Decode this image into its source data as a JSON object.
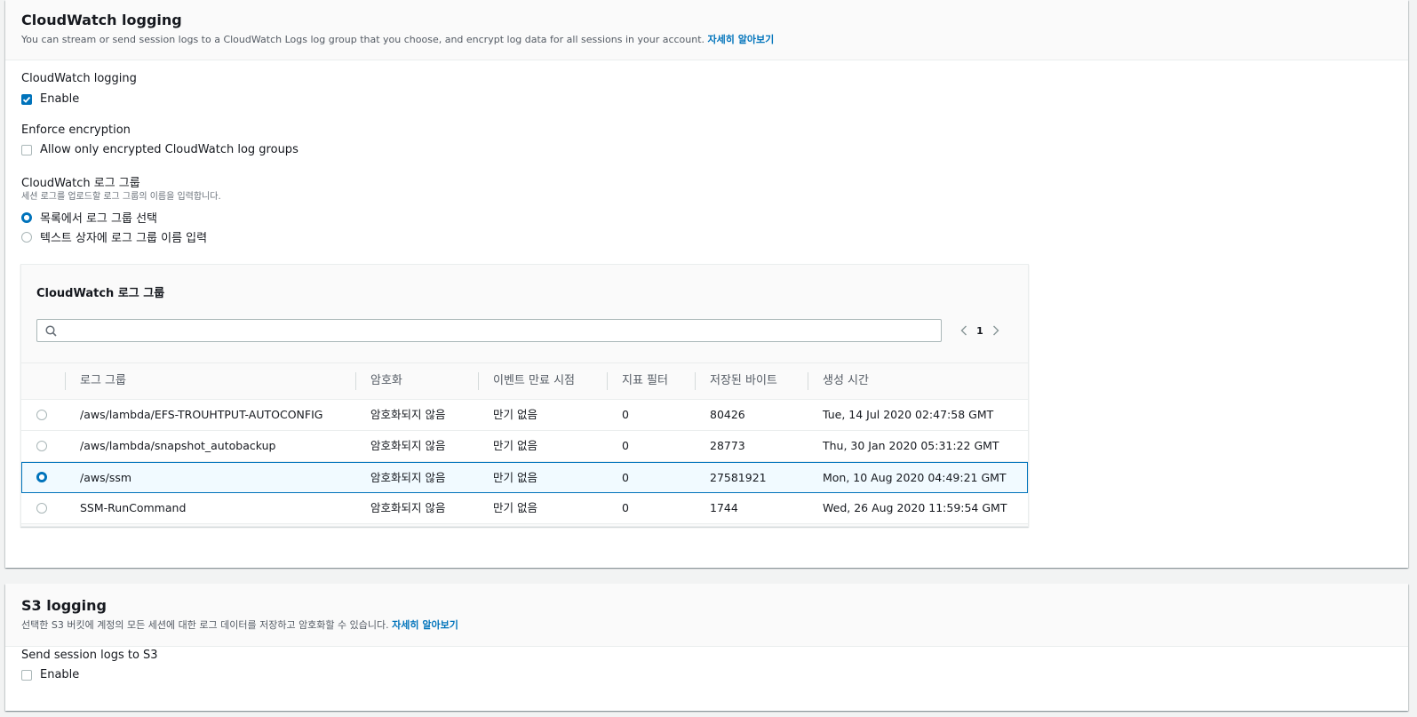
{
  "cloudwatch": {
    "title": "CloudWatch logging",
    "description": "You can stream or send session logs to a CloudWatch Logs log group that you choose, and encrypt log data for all sessions in your account.",
    "learn_more": "자세히 알아보기",
    "logging_label": "CloudWatch logging",
    "enable_label": "Enable",
    "enable_checked": true,
    "encryption_label": "Enforce encryption",
    "encryption_option": "Allow only encrypted CloudWatch log groups",
    "encryption_checked": false,
    "log_group_label": "CloudWatch 로그 그룹",
    "log_group_sub": "세션 로그를 업로드할 로그 그룹의 이름을 입력합니다.",
    "radio_select": "목록에서 로그 그룹 선택",
    "radio_text": "텍스트 상자에 로그 그룹 이름 입력",
    "selected_radio": "select"
  },
  "table": {
    "title": "CloudWatch 로그 그룹",
    "search_placeholder": "",
    "page": "1",
    "columns": [
      "로그 그룹",
      "암호화",
      "이벤트 만료 시점",
      "지표 필터",
      "저장된 바이트",
      "생성 시간"
    ],
    "rows": [
      {
        "name": "/aws/lambda/EFS-TROUHTPUT-AUTOCONFIG",
        "encryption": "암호화되지 않음",
        "expiry": "만기 없음",
        "filters": "0",
        "bytes": "80426",
        "created": "Tue, 14 Jul 2020 02:47:58 GMT",
        "selected": false
      },
      {
        "name": "/aws/lambda/snapshot_autobackup",
        "encryption": "암호화되지 않음",
        "expiry": "만기 없음",
        "filters": "0",
        "bytes": "28773",
        "created": "Thu, 30 Jan 2020 05:31:22 GMT",
        "selected": false
      },
      {
        "name": "/aws/ssm",
        "encryption": "암호화되지 않음",
        "expiry": "만기 없음",
        "filters": "0",
        "bytes": "27581921",
        "created": "Mon, 10 Aug 2020 04:49:21 GMT",
        "selected": true
      },
      {
        "name": "SSM-RunCommand",
        "encryption": "암호화되지 않음",
        "expiry": "만기 없음",
        "filters": "0",
        "bytes": "1744",
        "created": "Wed, 26 Aug 2020 11:59:54 GMT",
        "selected": false
      }
    ]
  },
  "s3": {
    "title": "S3 logging",
    "description": "선택한 S3 버킷에 계정의 모든 세션에 대한 로그 데이터를 저장하고 암호화할 수 있습니다.",
    "learn_more": "자세히 알아보기",
    "send_label": "Send session logs to S3",
    "enable_label": "Enable",
    "enable_checked": false
  },
  "colors": {
    "accent": "#0073bb",
    "selected_row_bg": "#f1faff"
  }
}
